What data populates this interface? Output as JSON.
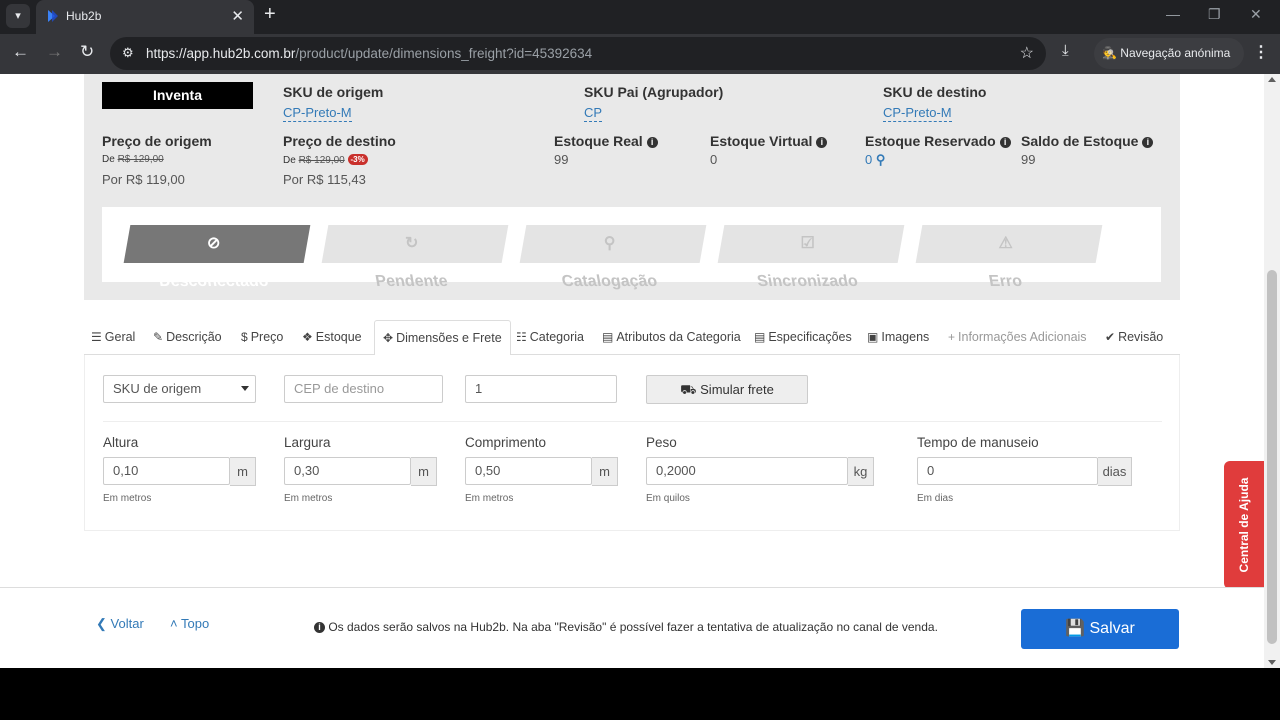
{
  "browser": {
    "tab_title": "Hub2b",
    "url_host": "https://app.hub2b.com.br",
    "url_path": "/product/update/dimensions_freight?id=45392634",
    "incognito_label": "Navegação anónima"
  },
  "product": {
    "channel_name": "Inventa",
    "sku_origin_label": "SKU de origem",
    "sku_origin_value": "CP-Preto-M",
    "sku_parent_label": "SKU Pai (Agrupador)",
    "sku_parent_value": "CP",
    "sku_dest_label": "SKU de destino",
    "sku_dest_value": "CP-Preto-M",
    "price_origin_label": "Preço de origem",
    "price_origin_de": "De",
    "price_origin_old": "R$ 129,00",
    "price_origin_now": "Por R$ 119,00",
    "price_dest_label": "Preço de destino",
    "price_dest_de": "De",
    "price_dest_old": "R$ 129,00",
    "price_dest_discount": "-3%",
    "price_dest_now": "Por R$ 115,43",
    "stock_real_label": "Estoque Real",
    "stock_real_value": "99",
    "stock_virtual_label": "Estoque Virtual",
    "stock_virtual_value": "0",
    "stock_reserved_label": "Estoque Reservado",
    "stock_reserved_value": "0",
    "stock_balance_label": "Saldo de Estoque",
    "stock_balance_value": "99"
  },
  "status": [
    {
      "label": "Desconectado",
      "icon": "ban-icon",
      "active": true
    },
    {
      "label": "Pendente",
      "icon": "refresh-icon",
      "active": false
    },
    {
      "label": "Catalogação",
      "icon": "search-icon",
      "active": false
    },
    {
      "label": "Sincronizado",
      "icon": "check-square-icon",
      "active": false
    },
    {
      "label": "Erro",
      "icon": "warning-icon",
      "active": false
    }
  ],
  "tabs": [
    {
      "label": "Geral",
      "icon": "list-icon"
    },
    {
      "label": "Descrição",
      "icon": "edit-icon"
    },
    {
      "label": "Preço",
      "icon": "dollar-icon"
    },
    {
      "label": "Estoque",
      "icon": "cubes-icon"
    },
    {
      "label": "Dimensões e Frete",
      "icon": "arrows-icon",
      "active": true
    },
    {
      "label": "Categoria",
      "icon": "sitemap-icon"
    },
    {
      "label": "Atributos da Categoria",
      "icon": "list-alt-icon"
    },
    {
      "label": "Especificações",
      "icon": "list-alt-icon"
    },
    {
      "label": "Imagens",
      "icon": "image-icon"
    },
    {
      "label": "Informações Adicionais",
      "icon": "plus-icon",
      "disabled": true
    },
    {
      "label": "Revisão",
      "icon": "check-circle-icon"
    }
  ],
  "freight": {
    "sku_select_value": "SKU de origem",
    "cep_placeholder": "CEP de destino",
    "quantity_value": "1",
    "simulate_label": "Simular frete"
  },
  "dimensions": {
    "height_label": "Altura",
    "height_value": "0,10",
    "height_unit": "m",
    "height_help": "Em metros",
    "width_label": "Largura",
    "width_value": "0,30",
    "width_unit": "m",
    "width_help": "Em metros",
    "length_label": "Comprimento",
    "length_value": "0,50",
    "length_unit": "m",
    "length_help": "Em metros",
    "weight_label": "Peso",
    "weight_value": "0,2000",
    "weight_unit": "kg",
    "weight_help": "Em quilos",
    "handling_label": "Tempo de manuseio",
    "handling_value": "0",
    "handling_unit": "dias",
    "handling_help": "Em dias"
  },
  "help_center_label": "Central de Ajuda",
  "footer": {
    "back_label": "Voltar",
    "top_label": "Topo",
    "note": "Os dados serão salvos na Hub2b. Na aba \"Revisão\" é possível fazer a tentativa de atualização no canal de venda.",
    "save_label": "Salvar"
  },
  "colors": {
    "primary": "#1a6dd6",
    "link": "#337ab7",
    "help_red": "#e03c3c",
    "panel_gray": "#e9e9e9"
  }
}
